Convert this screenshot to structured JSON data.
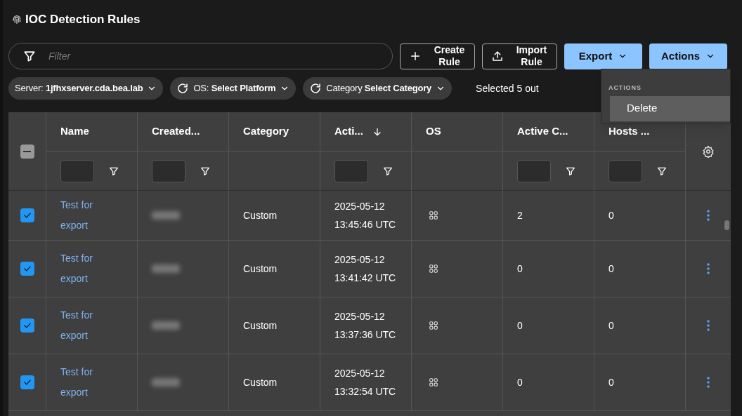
{
  "title": "IOC Detection Rules",
  "filter": {
    "placeholder": "Filter"
  },
  "buttons": [
    {
      "kind": "outline",
      "label": "Create Rule"
    },
    {
      "kind": "outline",
      "label": "Import Rule"
    },
    {
      "kind": "primary",
      "label": "Export"
    },
    {
      "kind": "primary",
      "label": "Actions"
    }
  ],
  "chips": [
    {
      "refresh": false,
      "label": "Server:",
      "value": "1jfhxserver.cda.bea.lab"
    },
    {
      "refresh": true,
      "label": "OS:",
      "value": "Select Platform"
    },
    {
      "refresh": true,
      "label": "Category",
      "value": "Select Category"
    }
  ],
  "selection_text": "Selected 5 out",
  "actions_menu": {
    "heading": "ACTIONS",
    "items": [
      {
        "label": "Delete",
        "selected": true
      }
    ]
  },
  "table": {
    "select_all_indeterminate": true,
    "columns": [
      {
        "label": "Name",
        "filter": true,
        "sort": false
      },
      {
        "label": "Created...",
        "filter": true,
        "sort": false
      },
      {
        "label": "Category",
        "filter": false,
        "sort": false
      },
      {
        "label": "Acti...",
        "filter": true,
        "sort": true
      },
      {
        "label": "OS",
        "filter": false,
        "sort": false
      },
      {
        "label": "Active C...",
        "filter": true,
        "sort": false
      },
      {
        "label": "Hosts ...",
        "filter": true,
        "sort": false
      }
    ],
    "rows": [
      {
        "checked": true,
        "name": [
          "Test for",
          "export"
        ],
        "category": "Custom",
        "date": "2025-05-12",
        "time": "13:45:46 UTC",
        "active": "2",
        "hosts": "0"
      },
      {
        "checked": true,
        "name": [
          "Test for",
          "export"
        ],
        "category": "Custom",
        "date": "2025-05-12",
        "time": "13:41:42 UTC",
        "active": "0",
        "hosts": "0"
      },
      {
        "checked": true,
        "name": [
          "Test for",
          "export"
        ],
        "category": "Custom",
        "date": "2025-05-12",
        "time": "13:37:36 UTC",
        "active": "0",
        "hosts": "0"
      },
      {
        "checked": true,
        "name": [
          "Test for",
          "export"
        ],
        "category": "Custom",
        "date": "2025-05-12",
        "time": "13:32:54 UTC",
        "active": "0",
        "hosts": "0"
      }
    ]
  }
}
